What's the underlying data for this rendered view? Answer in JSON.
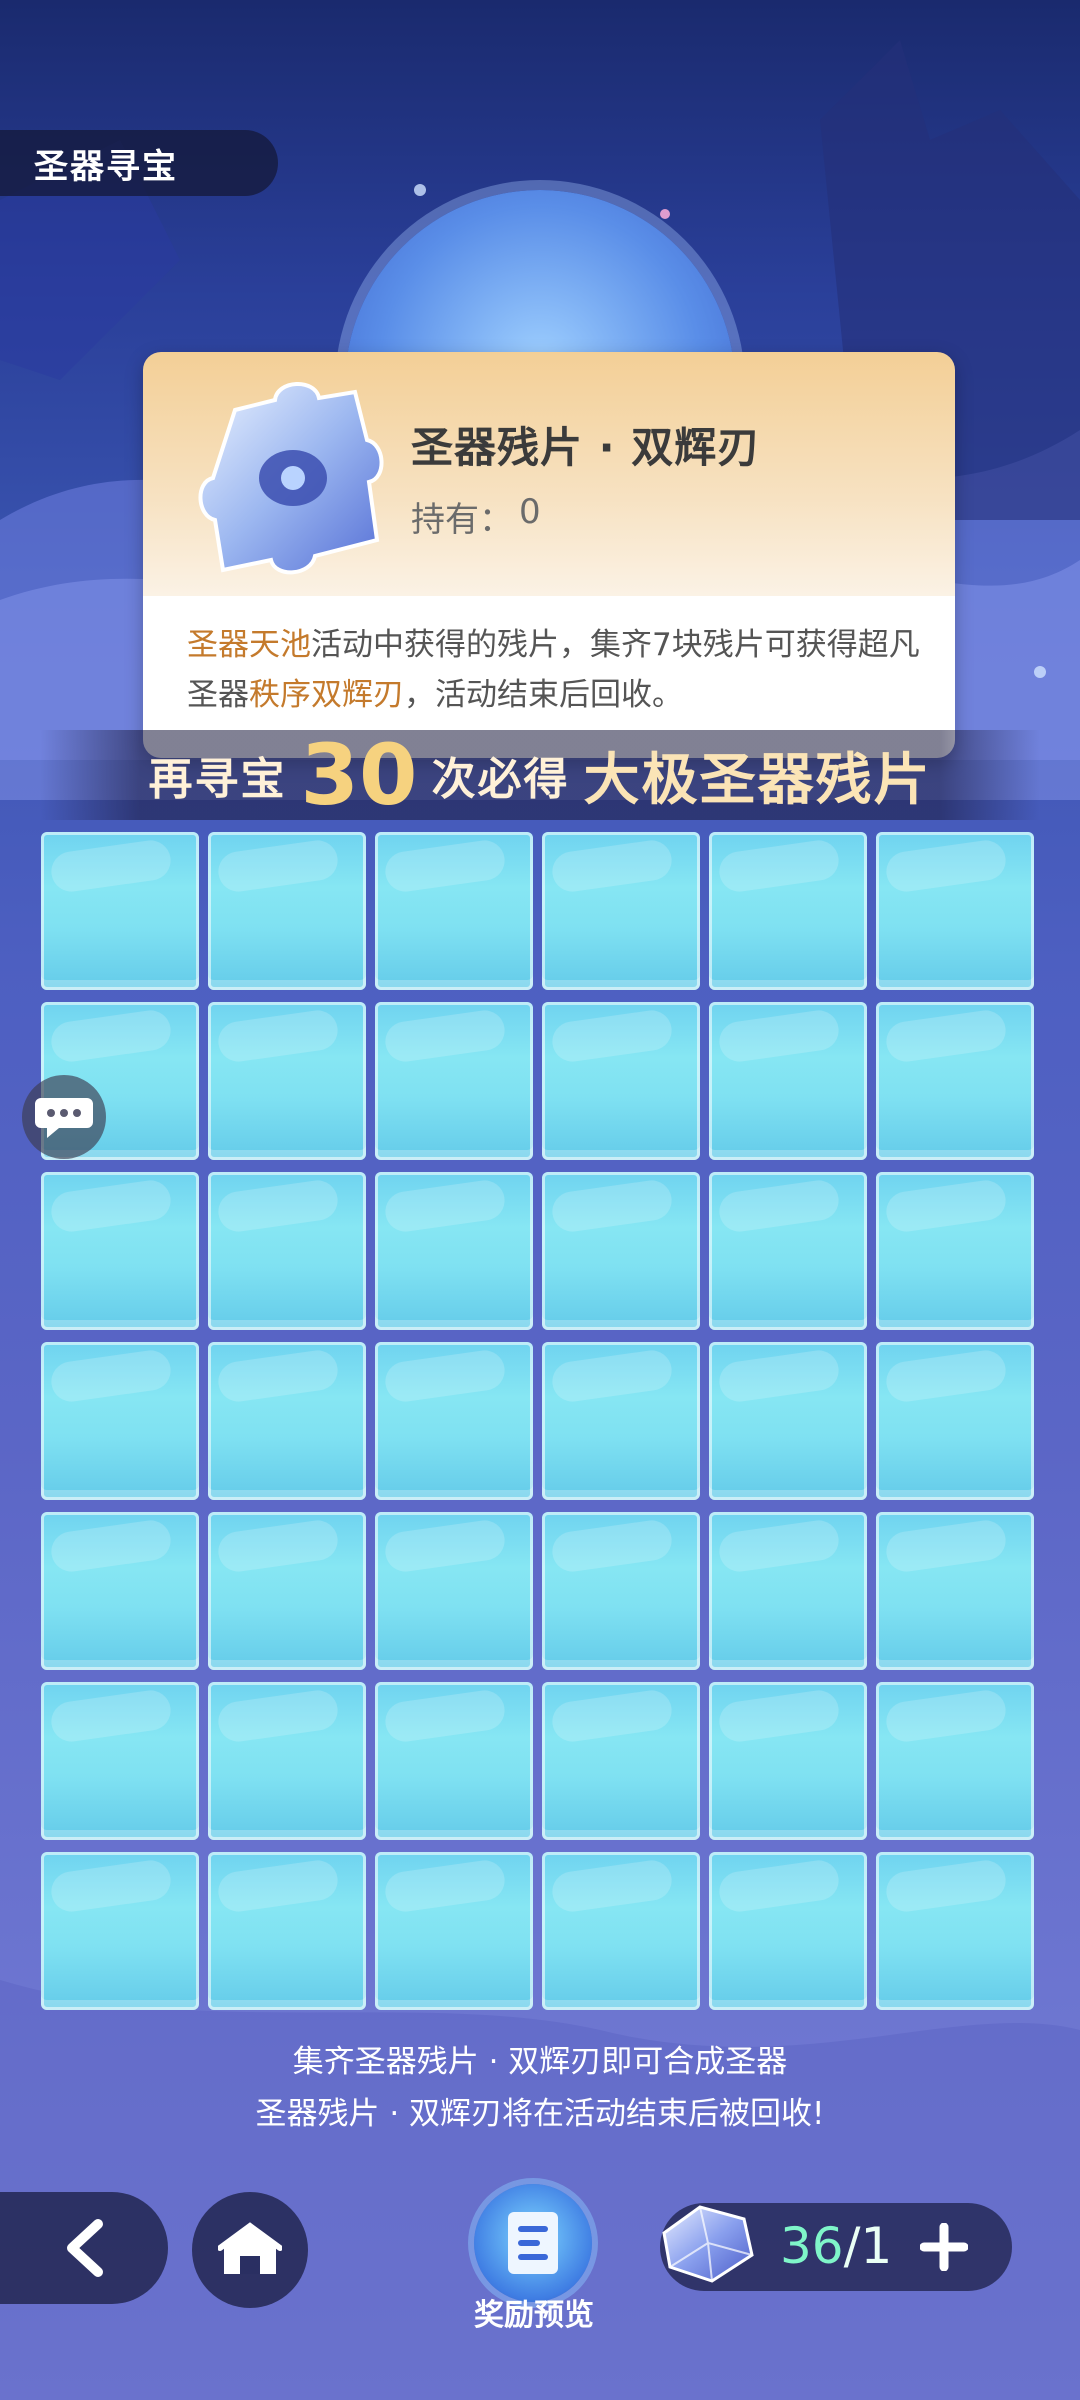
{
  "header": {
    "title": "圣器寻宝"
  },
  "popup": {
    "item_name": "圣器残片 · 双辉刃",
    "owned_label": "持有：",
    "owned_value": "0",
    "desc_hl1": "圣器天池",
    "desc_text1": "活动中获得的残片，集齐7块残片可获得超凡圣器",
    "desc_hl2": "秩序双辉刃",
    "desc_text2": "，活动结束后回收。",
    "icon": "puzzle-piece-icon"
  },
  "banner": {
    "prefix": "再寻宝",
    "number": "30",
    "middle": "次必得",
    "suffix": "大极圣器残片"
  },
  "grid": {
    "rows": 7,
    "columns": 6,
    "tile_state": "unopened"
  },
  "footer": {
    "line1": "集齐圣器残片 · 双辉刃即可合成圣器",
    "line2": "圣器残片 · 双辉刃将在活动结束后被回收!"
  },
  "nav": {
    "back_icon": "chevron-left-icon",
    "home_icon": "home-icon",
    "rewards_label": "奖励预览",
    "rewards_icon": "list-icon"
  },
  "counter": {
    "current": "36",
    "separator": "/",
    "total": "1",
    "plus_icon": "plus-icon",
    "gem_icon": "gem-icon"
  },
  "chat": {
    "icon": "chat-bubble-icon"
  },
  "colors": {
    "accent_orange": "#c47a2c",
    "counter_green": "#7ff5c9",
    "tile_cyan": "#7fe1f2"
  }
}
